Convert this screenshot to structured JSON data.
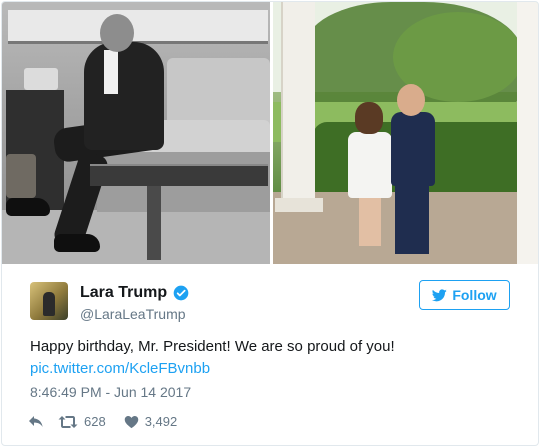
{
  "tweet": {
    "display_name": "Lara Trump",
    "handle": "@LaraLeaTrump",
    "follow_label": "Follow",
    "text": "Happy birthday, Mr. President! We are so proud of you!",
    "link": "pic.twitter.com/KcleFBvnbb",
    "timestamp": "8:46:49 PM - Jun 14 2017",
    "retweet_count": "628",
    "like_count": "3,492"
  },
  "icons": {
    "verified": "verified-badge-icon",
    "follow": "twitter-bird-icon",
    "reply": "reply-icon",
    "retweet": "retweet-icon",
    "like": "heart-icon"
  },
  "colors": {
    "accent": "#1da1f2",
    "muted": "#657786",
    "text": "#14171a",
    "border": "#e1e8ed"
  }
}
